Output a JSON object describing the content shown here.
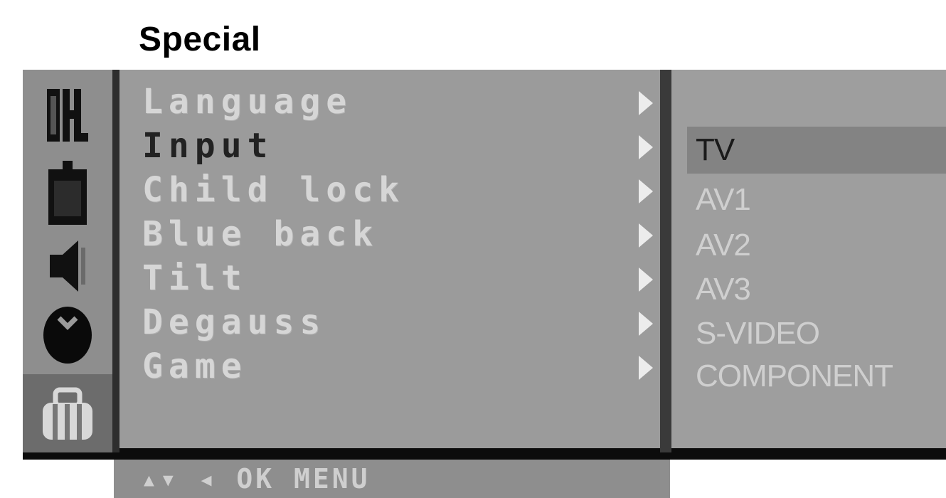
{
  "title": "Special",
  "icons": [
    {
      "name": "channel-icon"
    },
    {
      "name": "picture-icon"
    },
    {
      "name": "sound-icon"
    },
    {
      "name": "time-icon"
    },
    {
      "name": "special-icon",
      "selected": true
    }
  ],
  "menu": {
    "items": [
      {
        "label": "Language"
      },
      {
        "label": "Input",
        "active": true
      },
      {
        "label": "Child lock"
      },
      {
        "label": "Blue back"
      },
      {
        "label": "Tilt"
      },
      {
        "label": "Degauss"
      },
      {
        "label": "Game"
      }
    ]
  },
  "submenu": {
    "items": [
      {
        "label": "TV",
        "selected": true
      },
      {
        "label": "AV1"
      },
      {
        "label": "AV2"
      },
      {
        "label": "AV3"
      },
      {
        "label": "S-VIDEO"
      },
      {
        "label": "COMPONENT"
      }
    ]
  },
  "hint": "▴▾ ◂ OK MENU"
}
